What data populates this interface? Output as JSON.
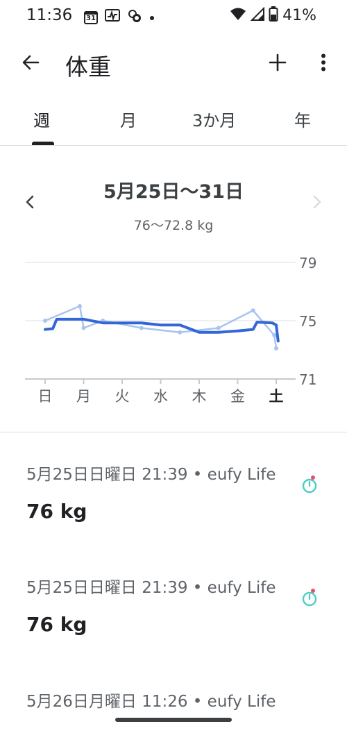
{
  "status_bar": {
    "time": "11:36",
    "calendar_day": "31",
    "battery_percent": "41%"
  },
  "app_bar": {
    "title": "体重"
  },
  "tabs": [
    {
      "label": "週",
      "selected": true
    },
    {
      "label": "月",
      "selected": false
    },
    {
      "label": "3か月",
      "selected": false
    },
    {
      "label": "年",
      "selected": false
    }
  ],
  "range": {
    "date_range": "5月25日〜31日",
    "weight_range": "76〜72.8 kg"
  },
  "chart_data": {
    "type": "line",
    "categories": [
      "日",
      "月",
      "火",
      "水",
      "木",
      "金",
      "土"
    ],
    "highlighted_category": "土",
    "y_ticks": [
      "79",
      "75",
      "71"
    ],
    "ylim": [
      71,
      79
    ],
    "series": [
      {
        "role": "daily-readings",
        "color": "#a8c4f0",
        "x": [
          0,
          0.9,
          1.0,
          1.5,
          2.5,
          3.5,
          4.5,
          5.4,
          5.95,
          6.0
        ],
        "y": [
          75,
          76,
          74.5,
          75,
          74.5,
          74.2,
          74.5,
          75.7,
          74,
          73.1
        ]
      },
      {
        "role": "trend",
        "color": "#3367d6",
        "x": [
          0,
          0.2,
          0.3,
          1.0,
          1.5,
          2.0,
          2.5,
          3.0,
          3.5,
          4.0,
          4.5,
          5.0,
          5.4,
          5.5,
          5.9,
          6.0,
          6.05
        ],
        "y": [
          74.4,
          74.45,
          75.1,
          75.1,
          74.85,
          74.85,
          74.85,
          74.7,
          74.7,
          74.2,
          74.2,
          74.3,
          74.4,
          74.9,
          74.85,
          74.7,
          73.6
        ]
      }
    ]
  },
  "entries": [
    {
      "meta": "5月25日日曜日 21:39 • eufy Life",
      "weight": "76 kg"
    },
    {
      "meta": "5月25日日曜日 21:39 • eufy Life",
      "weight": "76 kg"
    },
    {
      "meta": "5月26日月曜日 11:26 • eufy Life",
      "weight": ""
    }
  ],
  "colors": {
    "accent": "#3367d6",
    "accent_light": "#a8c4f0",
    "source_icon": "#4ecdc4",
    "source_icon_dot": "#e8506a"
  }
}
